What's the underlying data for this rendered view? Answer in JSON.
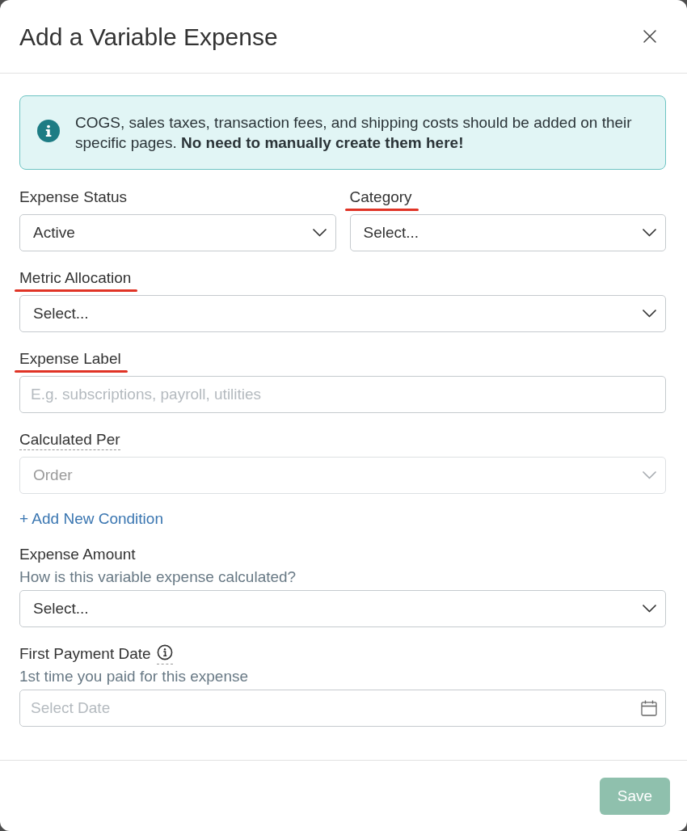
{
  "dialog": {
    "title": "Add a Variable Expense"
  },
  "notice": {
    "text": "COGS, sales taxes, transaction fees, and shipping costs should be added on their specific pages. **No need to manually create them here!**"
  },
  "form": [
    {
      "kind": "pair",
      "fields": [
        {
          "kind": "select",
          "label": "Expense Status",
          "value": "Active",
          "annotated": false,
          "tooltip": false,
          "info": false,
          "disabled": false
        },
        {
          "kind": "select",
          "label": "Category",
          "placeholder": "Select...",
          "annotated": true,
          "tooltip": false,
          "info": false,
          "disabled": false
        }
      ]
    },
    {
      "kind": "select",
      "label": "Metric Allocation",
      "placeholder": "Select...",
      "annotated": true,
      "tooltip": false,
      "info": false,
      "disabled": false
    },
    {
      "kind": "text",
      "label": "Expense Label",
      "placeholder": "E.g. subscriptions, payroll, utilities",
      "annotated": true,
      "tooltip": false,
      "info": false,
      "disabled": false
    },
    {
      "kind": "select",
      "label": "Calculated Per",
      "value": "Order",
      "annotated": false,
      "tooltip": true,
      "info": false,
      "disabled": true
    },
    {
      "kind": "link",
      "label": "+ Add New Condition"
    },
    {
      "kind": "select",
      "label": "Expense Amount",
      "hint": "How is this variable expense calculated?",
      "placeholder": "Select...",
      "annotated": false,
      "tooltip": false,
      "info": false,
      "disabled": false
    },
    {
      "kind": "date",
      "label": "First Payment Date",
      "info": true,
      "hint": "1st time you paid for this expense",
      "placeholder": "Select Date",
      "annotated": false,
      "tooltip": false,
      "disabled": false
    }
  ],
  "save_button": {
    "label": "Save",
    "disabled": true
  }
}
